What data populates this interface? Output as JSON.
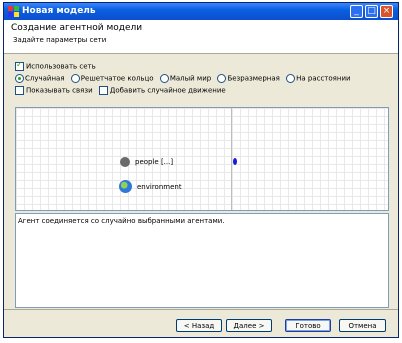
{
  "window": {
    "title": "Новая модель"
  },
  "header": {
    "title": "Создание агентной модели",
    "subtitle": "Задайте параметры сети"
  },
  "options": {
    "use_network": {
      "label": "Использовать сеть",
      "checked": true
    },
    "network_types": [
      {
        "label": "Случайная",
        "selected": true
      },
      {
        "label": "Решетчатое кольцо",
        "selected": false
      },
      {
        "label": "Малый мир",
        "selected": false
      },
      {
        "label": "Безразмерная",
        "selected": false
      },
      {
        "label": "На расстоянии",
        "selected": false
      }
    ],
    "show_links": {
      "label": "Показывать связи",
      "checked": false
    },
    "add_random_motion": {
      "label": "Добавить случайное движение",
      "checked": false
    }
  },
  "canvas": {
    "people_label": "people [...]",
    "environment_label": "environment"
  },
  "description": "Агент соединяется со случайно выбранными агентами.",
  "footer": {
    "back_label": "< Назад",
    "next_label": "Далее >",
    "finish_label": "Готово",
    "cancel_label": "Отмена"
  },
  "colors": {
    "titlebar": "#0b4fcf",
    "accent_green": "#21a121",
    "agent_dot": "#1a1adb"
  }
}
